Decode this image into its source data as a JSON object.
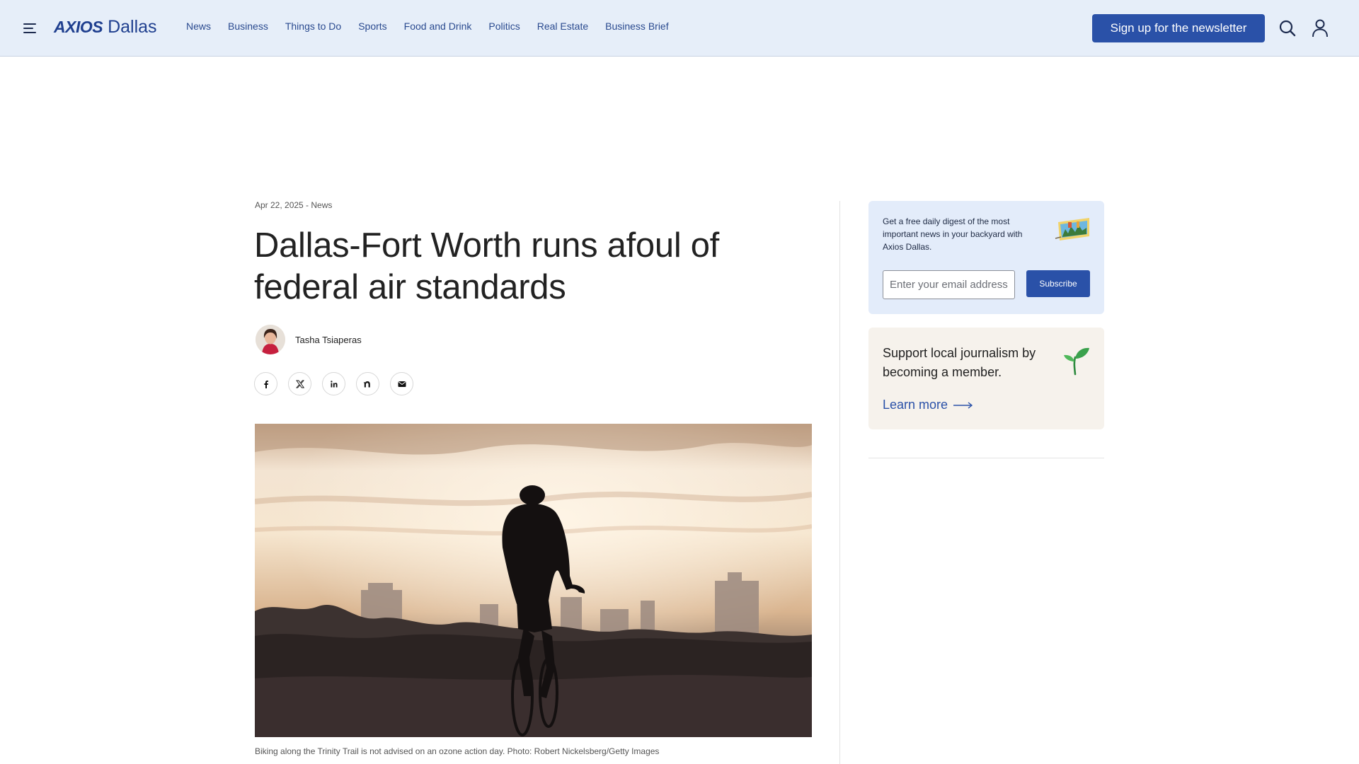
{
  "header": {
    "brand": "AXIOS",
    "city": "Dallas",
    "nav": [
      "News",
      "Business",
      "Things to Do",
      "Sports",
      "Food and Drink",
      "Politics",
      "Real Estate",
      "Business Brief"
    ],
    "signup_label": "Sign up for the newsletter"
  },
  "article": {
    "meta": "Apr 22, 2025 - News",
    "headline": "Dallas-Fort Worth runs afoul of federal air standards",
    "author": "Tasha Tsiaperas",
    "share_icons": [
      "facebook-icon",
      "x-icon",
      "linkedin-icon",
      "nextdoor-icon",
      "email-icon"
    ],
    "caption": "Biking along the Trinity Trail is not advised on an ozone action day. Photo: Robert Nickelsberg/Getty Images"
  },
  "sidebar": {
    "newsletter": {
      "text": "Get a free daily digest of the most important news in your backyard with Axios Dallas.",
      "email_placeholder": "Enter your email address",
      "subscribe_label": "Subscribe"
    },
    "membership": {
      "text": "Support local journalism by becoming a member.",
      "link_label": "Learn more"
    }
  },
  "colors": {
    "header_bg": "#e6eef9",
    "brand_blue": "#2a51a8",
    "newsletter_bg": "#e3ecfa",
    "member_bg": "#f6f2ec"
  }
}
